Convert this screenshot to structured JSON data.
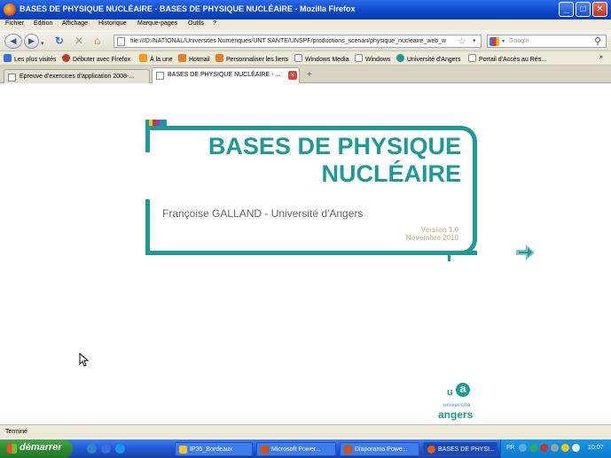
{
  "window": {
    "title": "BASES DE PHYSIQUE NUCLÉAIRE - BASES DE PHYSIQUE NUCLÉAIRE - Mozilla Firefox"
  },
  "menu": [
    "Fichier",
    "Édition",
    "Affichage",
    "Historique",
    "Marque-pages",
    "Outils",
    "?"
  ],
  "nav": {
    "url": "file:///D:/NATIONAL/Universités Numériques/UNT SANTE/UNSPF/productions_scenari/physique_nucleaire_web_w",
    "search_placeholder": "Google"
  },
  "bookmarks": [
    {
      "label": "Les plus visités",
      "icon": "bookmark-icon",
      "color": "#3b6fe0"
    },
    {
      "label": "Débuter avec Firefox",
      "icon": "firefox-icon",
      "color": "#c0392b"
    },
    {
      "label": "À la une",
      "icon": "rss-icon",
      "color": "#f39c12"
    },
    {
      "label": "Hotmail",
      "icon": "msn-icon",
      "color": "#e67e22"
    },
    {
      "label": "Personnaliser les liens",
      "icon": "msn-icon",
      "color": "#e67e22"
    },
    {
      "label": "Windows Media",
      "icon": "page-icon",
      "color": "#ffffff"
    },
    {
      "label": "Windows",
      "icon": "page-icon",
      "color": "#ffffff"
    },
    {
      "label": "Université d'Angers",
      "icon": "ua-icon",
      "color": "#1e9a96"
    },
    {
      "label": "Portail d'Accès au Rés...",
      "icon": "page-icon",
      "color": "#ffffff"
    }
  ],
  "bookmarks_more": "»",
  "tabs": [
    {
      "label": "Epreuve d'exercices d'application 2008-..."
    },
    {
      "label": "BASES DE PHYSIQUE NUCLÉAIRE - ..."
    }
  ],
  "doc": {
    "title": "BASES DE PHYSIQUE NUCLÉAIRE",
    "author": "Françoise GALLAND - Université d'Angers",
    "version": "Version 1.0",
    "date": "Novembre 2010",
    "logo_letters": "ua",
    "logo_univ": "université",
    "logo_name": "angers",
    "accent": "#1e9a96"
  },
  "status": "Terminé",
  "taskbar": {
    "start": "démarrer",
    "tasks": [
      "IP35_Bordeaux",
      "Microsoft Power...",
      "Diaporama Powe...",
      "BASES DE PHYSI..."
    ],
    "lang": "FR",
    "clock": "10:07"
  }
}
